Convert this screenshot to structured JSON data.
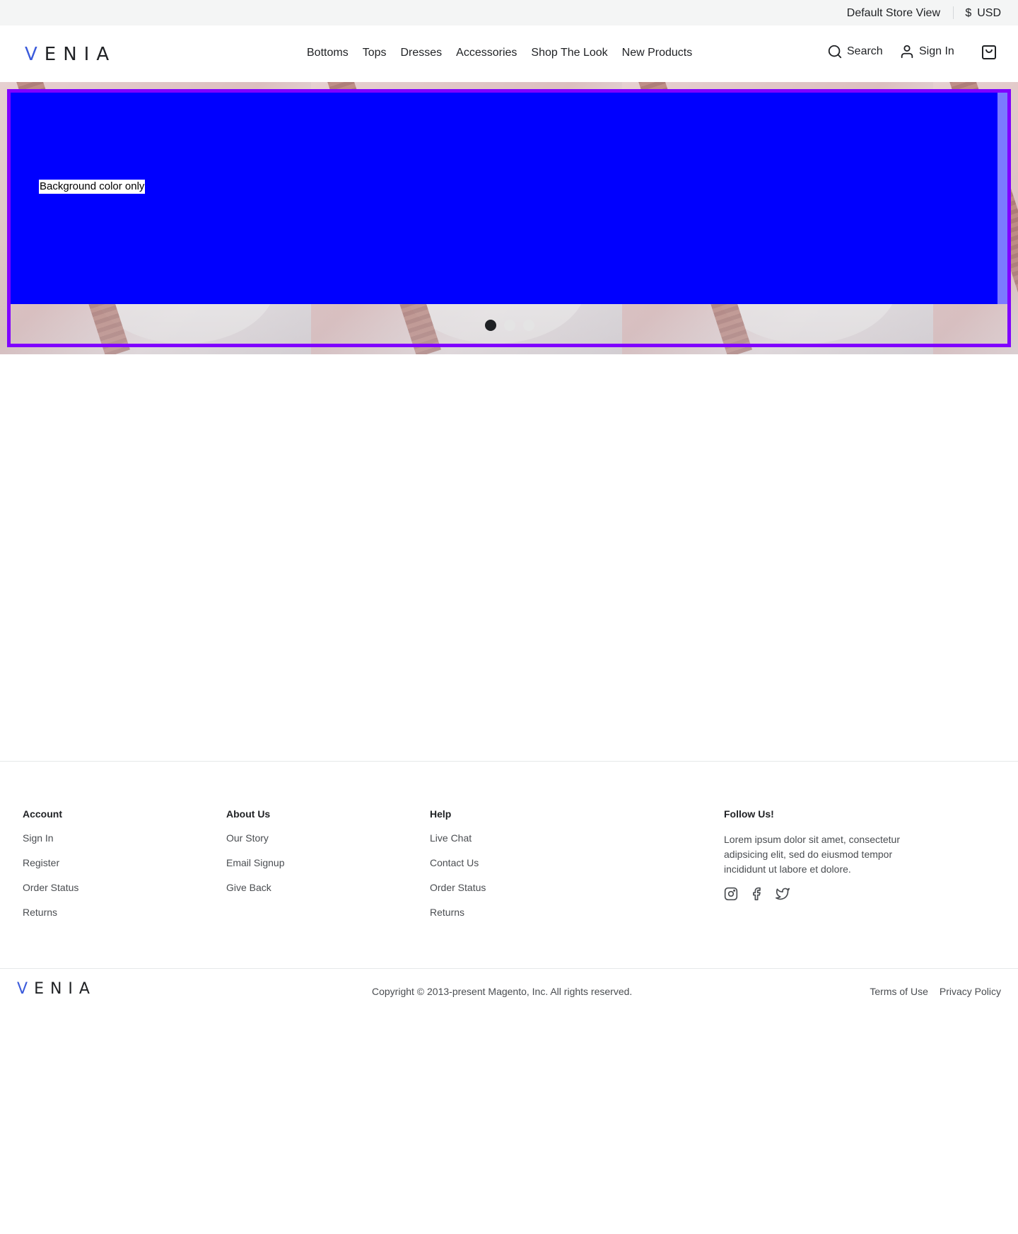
{
  "topbar": {
    "store_view": "Default Store View",
    "currency_symbol": "$",
    "currency_code": "USD"
  },
  "header": {
    "logo": "VENIA",
    "nav": [
      "Bottoms",
      "Tops",
      "Dresses",
      "Accessories",
      "Shop The Look",
      "New Products"
    ],
    "search_label": "Search",
    "signin_label": "Sign In",
    "cart_icon": "shopping-bag-icon"
  },
  "hero": {
    "slide_text": "Background color only",
    "slide_color": "#0000ff",
    "frame_color": "#8000ff",
    "slide_count": 3,
    "active_slide": 1
  },
  "footer": {
    "account": {
      "title": "Account",
      "links": [
        "Sign In",
        "Register",
        "Order Status",
        "Returns"
      ]
    },
    "about": {
      "title": "About Us",
      "links": [
        "Our Story",
        "Email Signup",
        "Give Back"
      ]
    },
    "help": {
      "title": "Help",
      "links": [
        "Live Chat",
        "Contact Us",
        "Order Status",
        "Returns"
      ]
    },
    "follow": {
      "title": "Follow Us!",
      "text": "Lorem ipsum dolor sit amet, consectetur adipsicing elit, sed do eiusmod tempor incididunt ut labore et dolore.",
      "icons": [
        "instagram-icon",
        "facebook-icon",
        "twitter-icon"
      ]
    },
    "logo": "VENIA",
    "copyright": "Copyright © 2013-present Magento, Inc. All rights reserved.",
    "terms": "Terms of Use",
    "privacy": "Privacy Policy"
  }
}
